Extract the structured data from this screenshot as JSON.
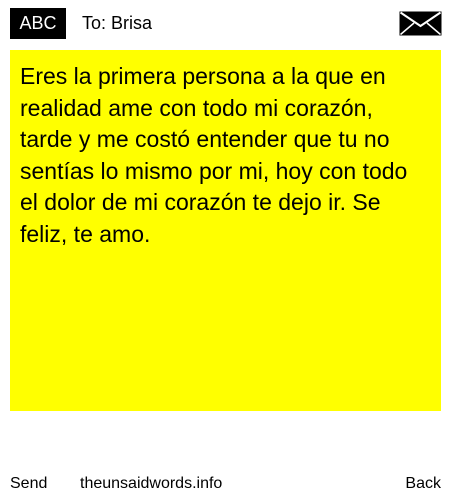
{
  "header": {
    "badge": "ABC",
    "recipient": "To: Brisa",
    "mail_icon": "envelope-icon"
  },
  "message": {
    "text": "Eres la primera persona a la que en realidad ame con todo mi corazón, tarde y me costó entender que tu no sentías lo mismo por mi, hoy con todo el dolor de mi corazón te dejo ir. Se feliz, te amo."
  },
  "footer": {
    "send_label": "Send",
    "site": "theunsaidwords.info",
    "back_label": "Back"
  },
  "colors": {
    "message_background": "#ffff00",
    "badge_background": "#000000",
    "page_background": "#ffffff"
  }
}
